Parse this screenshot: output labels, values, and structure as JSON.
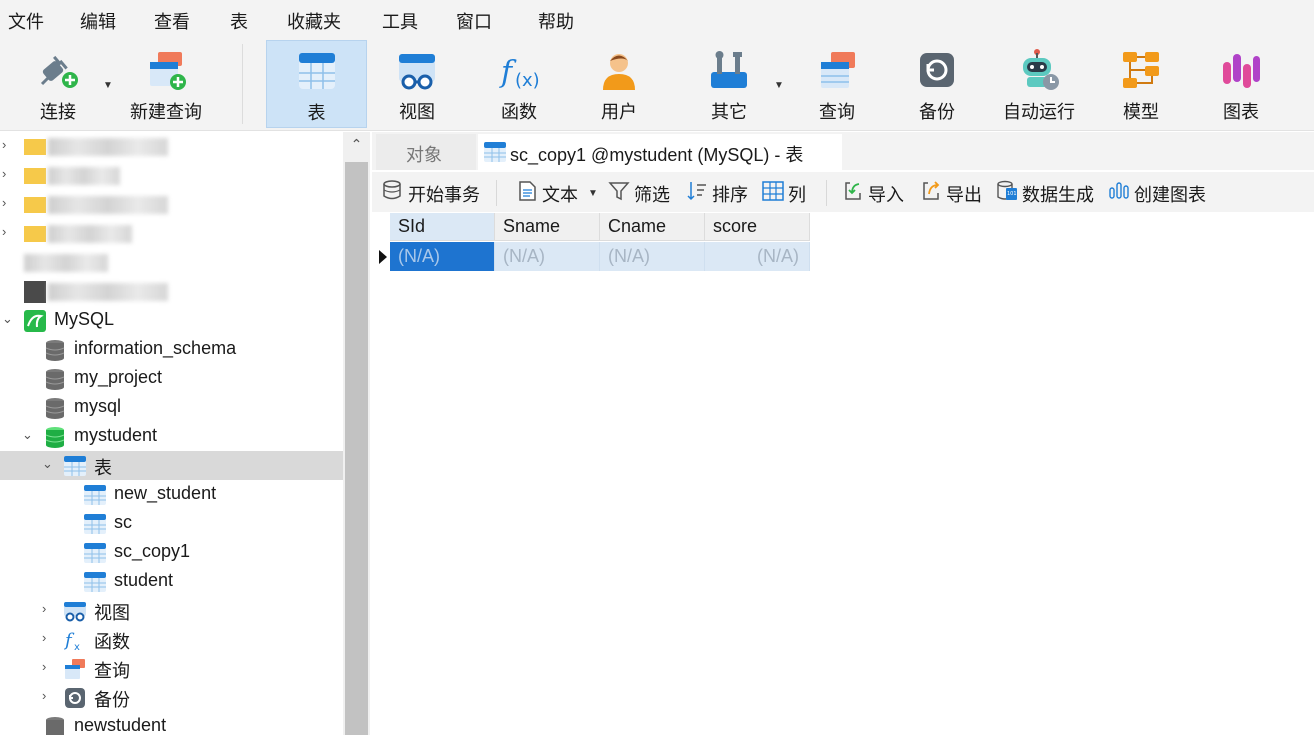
{
  "menu": [
    "文件",
    "编辑",
    "查看",
    "表",
    "收藏夹",
    "工具",
    "窗口",
    "帮助"
  ],
  "toolbar": {
    "items": [
      {
        "label": "连接",
        "icon": "plug-icon"
      },
      {
        "label": "新建查询",
        "icon": "new-query-icon"
      },
      {
        "label": "表",
        "icon": "table-icon"
      },
      {
        "label": "视图",
        "icon": "view-icon"
      },
      {
        "label": "函数",
        "icon": "function-icon"
      },
      {
        "label": "用户",
        "icon": "user-icon"
      },
      {
        "label": "其它",
        "icon": "tools-icon"
      },
      {
        "label": "查询",
        "icon": "query-icon"
      },
      {
        "label": "备份",
        "icon": "backup-icon"
      },
      {
        "label": "自动运行",
        "icon": "robot-icon"
      },
      {
        "label": "模型",
        "icon": "model-icon"
      },
      {
        "label": "图表",
        "icon": "chart-icon"
      }
    ]
  },
  "sidebar": {
    "connection": "MySQL",
    "databases": [
      "information_schema",
      "my_project",
      "mysql",
      "mystudent"
    ],
    "folder_tables": "表",
    "tables": [
      "new_student",
      "sc",
      "sc_copy1",
      "student"
    ],
    "folders": [
      "视图",
      "函数",
      "查询",
      "备份"
    ],
    "last_db": "newstudent"
  },
  "tabs": {
    "objects": "对象",
    "current": "sc_copy1 @mystudent (MySQL) - 表"
  },
  "subtoolbar": {
    "begin_tx": "开始事务",
    "text": "文本",
    "filter": "筛选",
    "sort": "排序",
    "columns": "列",
    "import": "导入",
    "export": "导出",
    "datagen": "数据生成",
    "create_chart": "创建图表"
  },
  "grid": {
    "columns": [
      "SId",
      "Sname",
      "Cname",
      "score"
    ],
    "row": [
      "(N/A)",
      "(N/A)",
      "(N/A)",
      "(N/A)"
    ]
  },
  "colors": {
    "accent": "#1e74d0",
    "selection_row": "#dbe8f5",
    "active_tool": "#cde3f7"
  }
}
